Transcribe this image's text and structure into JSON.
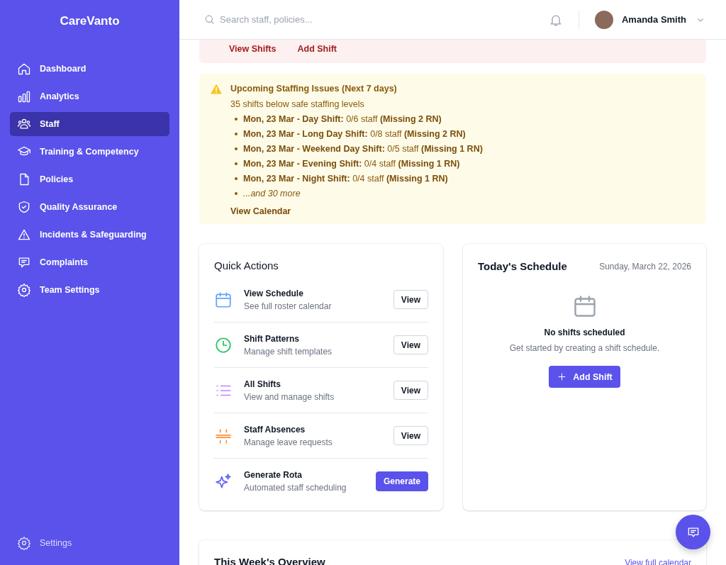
{
  "sidebar": {
    "brand": "CareVanto",
    "items": [
      {
        "label": "Dashboard",
        "selected": false
      },
      {
        "label": "Analytics",
        "selected": false
      },
      {
        "label": "Staff",
        "selected": true
      },
      {
        "label": "Training & Competency",
        "selected": false
      },
      {
        "label": "Policies",
        "selected": false
      },
      {
        "label": "Quality Assurance",
        "selected": false
      },
      {
        "label": "Incidents & Safeguarding",
        "selected": false
      },
      {
        "label": "Complaints",
        "selected": false
      },
      {
        "label": "Team Settings",
        "selected": false
      }
    ],
    "footer": {
      "label": "Settings"
    }
  },
  "header": {
    "search": {
      "placeholder": "Search staff, policies..."
    },
    "user": {
      "name": "Amanda Smith"
    }
  },
  "shift_banner": {
    "links": [
      "View Shifts",
      "Add Shift"
    ]
  },
  "staffing_alert": {
    "title": "Upcoming Staffing Issues (Next 7 days)",
    "summary": "35 shifts below safe staffing levels",
    "items": [
      "**Mon, 23 Mar - Day Shift:** 0/6 staff **(Missing 2 RN)**",
      "**Mon, 23 Mar - Long Day Shift:** 0/8 staff **(Missing 2 RN)**",
      "**Mon, 23 Mar - Weekend Day Shift:** 0/5 staff **(Missing 1 RN)**",
      "**Mon, 23 Mar - Evening Shift:** 0/4 staff **(Missing 1 RN)**",
      "**Mon, 23 Mar - Night Shift:** 0/4 staff **(Missing 1 RN)**",
      "*...and 30 more*"
    ],
    "link": "View Calendar"
  },
  "quick_actions": {
    "title": "Quick Actions",
    "items": [
      {
        "title": "View Schedule",
        "subtitle": "See full roster calendar",
        "button": "View",
        "kind": "outline"
      },
      {
        "title": "Shift Patterns",
        "subtitle": "Manage shift templates",
        "button": "View",
        "kind": "outline"
      },
      {
        "title": "All Shifts",
        "subtitle": "View and manage shifts",
        "button": "View",
        "kind": "outline"
      },
      {
        "title": "Staff Absences",
        "subtitle": "Manage leave requests",
        "button": "View",
        "kind": "outline"
      },
      {
        "title": "Generate Rota",
        "subtitle": "Automated staff scheduling",
        "button": "Generate",
        "kind": "primary"
      }
    ]
  },
  "todays_schedule": {
    "title": "Today's Schedule",
    "date": "Sunday, March 22, 2026",
    "empty_title": "No shifts scheduled",
    "empty_text": "Get started by creating a shift schedule.",
    "button": "Add Shift"
  },
  "weekly_overview": {
    "title": "This Week's Overview",
    "link": "View full calendar"
  }
}
